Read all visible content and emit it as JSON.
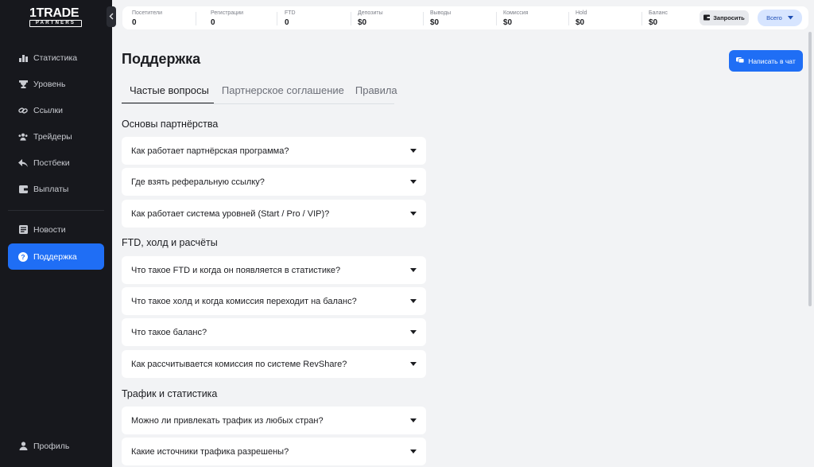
{
  "sidebar": {
    "brand": "1TRADE",
    "brand_sub": "PARTNERS",
    "items": [
      {
        "label": "Статистика",
        "icon": "bar-chart-icon"
      },
      {
        "label": "Уровень",
        "icon": "trophy-icon"
      },
      {
        "label": "Ссылки",
        "icon": "link-icon"
      },
      {
        "label": "Трейдеры",
        "icon": "users-icon"
      },
      {
        "label": "Постбеки",
        "icon": "reply-icon"
      },
      {
        "label": "Выплаты",
        "icon": "wallet-icon"
      }
    ],
    "secondary": [
      {
        "label": "Новости",
        "icon": "news-icon"
      },
      {
        "label": "Поддержка",
        "icon": "help-icon",
        "active": true
      }
    ],
    "profile": {
      "label": "Профиль",
      "icon": "user-icon"
    }
  },
  "stats": [
    {
      "label": "Посетители",
      "value": "0"
    },
    {
      "label": "Регистрации",
      "value": "0"
    },
    {
      "label": "FTD",
      "value": "0"
    },
    {
      "label": "Депозиты",
      "value": "$0"
    },
    {
      "label": "Выводы",
      "value": "$0"
    },
    {
      "label": "Комиссия",
      "value": "$0"
    },
    {
      "label": "Hold",
      "value": "$0"
    },
    {
      "label": "Баланс",
      "value": "$0"
    }
  ],
  "toolbar": {
    "request_label": "Запросить",
    "filter_label": "Всего"
  },
  "page": {
    "title": "Поддержка",
    "chat_button": "Написать в чат",
    "tabs": [
      "Частые вопросы",
      "Партнерское соглашение",
      "Правила"
    ]
  },
  "sections": [
    {
      "title": "Основы партнёрства",
      "questions": [
        "Как работает партнёрская программа?",
        "Где взять реферальную ссылку?",
        "Как работает система уровней (Start / Pro / VIP)?"
      ]
    },
    {
      "title": "FTD, холд и расчёты",
      "questions": [
        "Что такое FTD и когда он появляется в статистике?",
        "Что такое холд и когда комиссия переходит на баланс?",
        "Что такое баланс?",
        "Как рассчитывается комиссия по системе RevShare?"
      ]
    },
    {
      "title": "Трафик и статистика",
      "questions": [
        "Можно ли привлекать трафик из любых стран?",
        "Какие источники трафика разрешены?"
      ]
    }
  ],
  "colors": {
    "accent": "#1f6ef5",
    "sidebar_bg": "#17181d",
    "page_bg": "#f2f3f5"
  }
}
